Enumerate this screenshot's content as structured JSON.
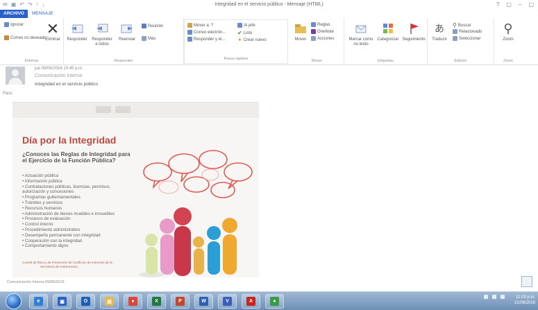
{
  "window": {
    "title": "Integridad en el servicio público - Mensaje (HTML)",
    "qat_icons": [
      "outlook-icon",
      "save-icon",
      "undo-icon",
      "redo-icon",
      "up-icon",
      "down-icon"
    ],
    "controls": [
      "?",
      "▢",
      "–",
      "▢"
    ]
  },
  "tabs": {
    "file": "ARCHIVO",
    "message": "MENSAJE"
  },
  "ribbon": {
    "ignore": "Ignorar",
    "junk": "Correo no deseado",
    "delete": "Eliminar",
    "reply": "Responder",
    "reply_all_line1": "Responder",
    "reply_all_line2": "a todos",
    "forward": "Reenviar",
    "meeting": "Reunión",
    "more": "Más",
    "move_to": "Mover a: ?",
    "email_manager": "Correo electrón...",
    "reply_delete": "Responder y el...",
    "to_manager": "Al jefe",
    "done": "Listo",
    "create_new": "Crear nuevo",
    "move": "Mover",
    "rules": "Reglas",
    "onenote": "OneNote",
    "actions": "Acciones",
    "mark_unread_line1": "Marcar como",
    "mark_unread_line2": "no leído",
    "categorize": "Categorizar",
    "followup": "Seguimiento",
    "translate": "Traducir",
    "find": "Buscar",
    "related": "Relacionado",
    "select": "Seleccionar",
    "zoom": "Zoom",
    "groups": [
      "Eliminar",
      "Responder",
      "Pasos rápidos",
      "Mover",
      "Etiquetas",
      "Edición",
      "Zoom"
    ]
  },
  "message": {
    "date": "jue 09/06/2016 10:45 p.m.",
    "sender": "Comunicación Interna",
    "subject": "Integridad en el servicio público",
    "to_label": "Para:"
  },
  "poster": {
    "title": "Día por la Integridad",
    "question_line1": "¿Conoces las Reglas de Integridad para",
    "question_line2": "el Ejercicio de la Función Pública?",
    "items": [
      "• Actuación pública",
      "• Información pública",
      "• Contrataciones públicas, licencias, permisos,",
      "   autorización y concesiones",
      "• Programas gubernamentales",
      "• Trámites y servicios",
      "• Recursos humanos",
      "• Administración de bienes muebles e inmuebles",
      "• Procesos de evaluación",
      "• Control interno",
      "• Procedimiento administrativo",
      "• Desempeño permanente con integridad",
      "• Cooperación con la integridad",
      "• Comportamiento digno"
    ],
    "footer_line1": "Comité de Ética y de Prevención de Conflictos de Intereses de la",
    "footer_line2": "Secretaría de Gobernación",
    "person_colors": [
      "#d9e4a8",
      "#e89bc8",
      "#c8384a",
      "#e7b24a",
      "#2c9ed6",
      "#f0a930"
    ],
    "bubble_color": "#e05a50"
  },
  "attachment_note": "Comunicación Interna 09/06/2016",
  "taskbar": {
    "apps": [
      {
        "name": "ie-icon",
        "glyph": "e",
        "color": "#2f7fd4"
      },
      {
        "name": "outlook-window-icon",
        "glyph": "▣",
        "color": "#2a62c9"
      },
      {
        "name": "outlook-icon",
        "glyph": "O",
        "color": "#1f5fb3"
      },
      {
        "name": "explorer-icon",
        "glyph": "▤",
        "color": "#e6b84d"
      },
      {
        "name": "chrome-icon",
        "glyph": "●",
        "color": "#d9473b"
      },
      {
        "name": "excel-icon",
        "glyph": "X",
        "color": "#1e7a3c"
      },
      {
        "name": "powerpoint-icon",
        "glyph": "P",
        "color": "#c4462c"
      },
      {
        "name": "word-icon",
        "glyph": "W",
        "color": "#2b5fb0"
      },
      {
        "name": "visio-icon",
        "glyph": "V",
        "color": "#3b5fb8"
      },
      {
        "name": "acrobat-icon",
        "glyph": "A",
        "color": "#c8231d"
      },
      {
        "name": "browser-icon",
        "glyph": "●",
        "color": "#3a9b45"
      }
    ],
    "time": "11:03 p.m.",
    "date": "21/06/2016"
  }
}
